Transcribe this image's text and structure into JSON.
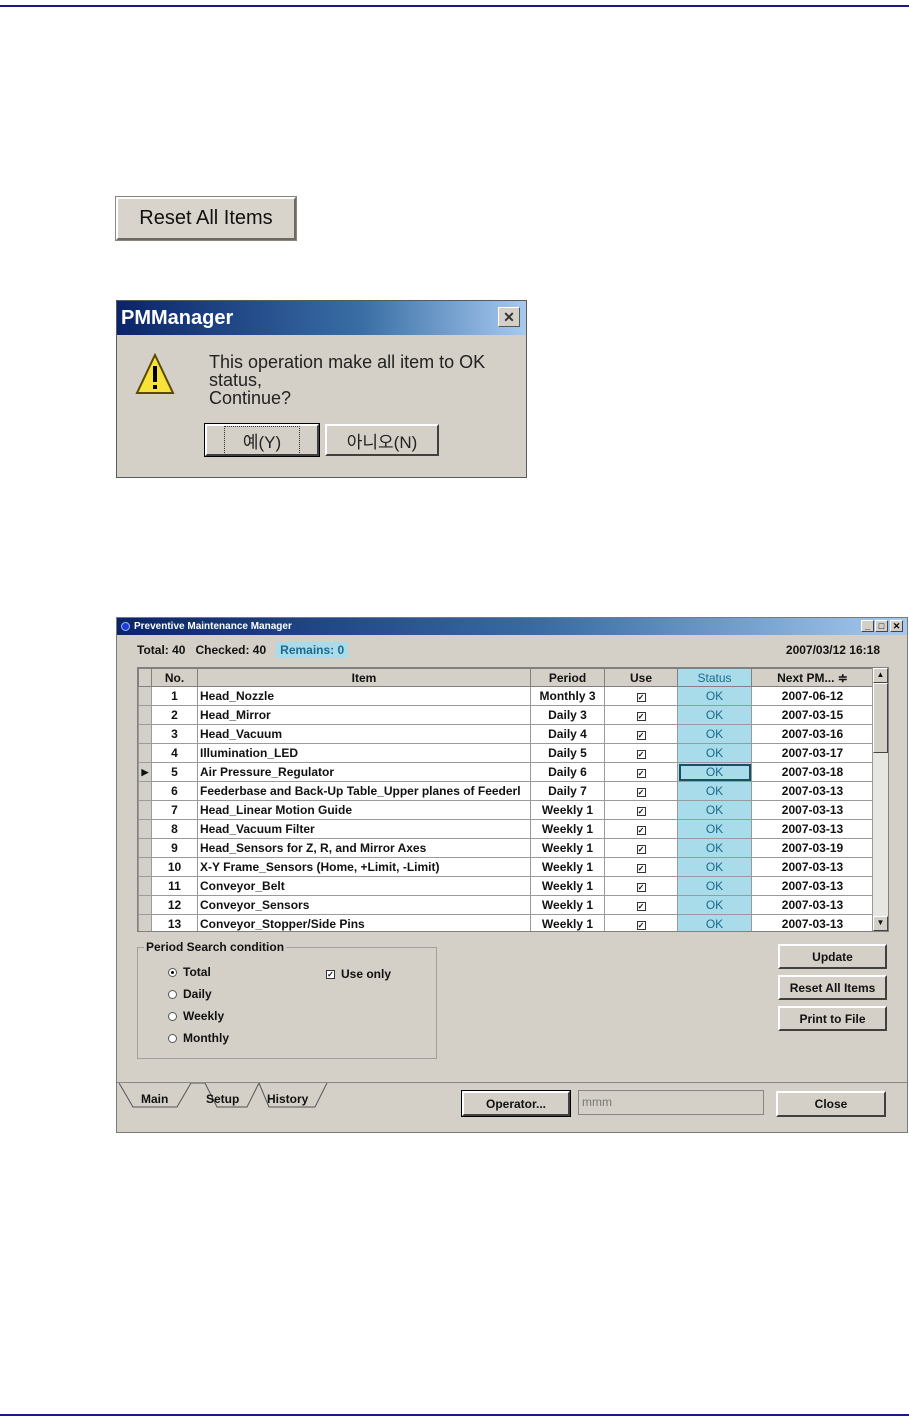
{
  "reset_button_label": "Reset All Items",
  "dialog": {
    "title": "PMManager",
    "close_glyph": "✕",
    "message_line1": "This operation make all item to OK status,",
    "message_line2": "Continue?",
    "yes_label": "예(Y)",
    "no_label": "아니오(N)"
  },
  "window": {
    "title": "Preventive Maintenance Manager",
    "summary": {
      "total": "Total: 40",
      "checked": "Checked: 40",
      "remains": "Remains: 0",
      "datetime": "2007/03/12 16:18"
    },
    "columns": [
      "No.",
      "Item",
      "Period",
      "Use",
      "Status",
      "Next PM...  ≑"
    ],
    "rows": [
      {
        "no": "1",
        "item": "Head_Nozzle",
        "period": "Monthly 3",
        "status": "OK",
        "next": "2007-06-12"
      },
      {
        "no": "2",
        "item": "Head_Mirror",
        "period": "Daily 3",
        "status": "OK",
        "next": "2007-03-15"
      },
      {
        "no": "3",
        "item": "Head_Vacuum",
        "period": "Daily 4",
        "status": "OK",
        "next": "2007-03-16"
      },
      {
        "no": "4",
        "item": "Illumination_LED",
        "period": "Daily 5",
        "status": "OK",
        "next": "2007-03-17"
      },
      {
        "no": "5",
        "item": "Air Pressure_Regulator",
        "period": "Daily 6",
        "status": "OK",
        "next": "2007-03-18"
      },
      {
        "no": "6",
        "item": "Feederbase and Back-Up Table_Upper planes of Feederl",
        "period": "Daily 7",
        "status": "OK",
        "next": "2007-03-13"
      },
      {
        "no": "7",
        "item": "Head_Linear Motion Guide",
        "period": "Weekly 1",
        "status": "OK",
        "next": "2007-03-13"
      },
      {
        "no": "8",
        "item": "Head_Vacuum Filter",
        "period": "Weekly 1",
        "status": "OK",
        "next": "2007-03-13"
      },
      {
        "no": "9",
        "item": "Head_Sensors for Z, R, and Mirror Axes",
        "period": "Weekly 1",
        "status": "OK",
        "next": "2007-03-19"
      },
      {
        "no": "10",
        "item": "X-Y Frame_Sensors (Home, +Limit, -Limit)",
        "period": "Weekly 1",
        "status": "OK",
        "next": "2007-03-13"
      },
      {
        "no": "11",
        "item": "Conveyor_Belt",
        "period": "Weekly 1",
        "status": "OK",
        "next": "2007-03-13"
      },
      {
        "no": "12",
        "item": "Conveyor_Sensors",
        "period": "Weekly 1",
        "status": "OK",
        "next": "2007-03-13"
      },
      {
        "no": "13",
        "item": "Conveyor_Stopper/Side Pins",
        "period": "Weekly 1",
        "status": "OK",
        "next": "2007-03-13"
      }
    ],
    "search": {
      "title": "Period Search condition",
      "options": [
        "Total",
        "Daily",
        "Weekly",
        "Monthly"
      ],
      "selected": "Total",
      "use_only_label": "Use only"
    },
    "buttons": {
      "update": "Update",
      "reset_all": "Reset All Items",
      "print": "Print to File",
      "operator": "Operator...",
      "close": "Close"
    },
    "operator_value": "mmm",
    "tabs": [
      "Main",
      "Setup",
      "History"
    ],
    "active_tab": "Main"
  },
  "colors": {
    "status_bg": "#a9dcea",
    "title_blue": "#0a246a",
    "rule": "#1a1a8c"
  }
}
